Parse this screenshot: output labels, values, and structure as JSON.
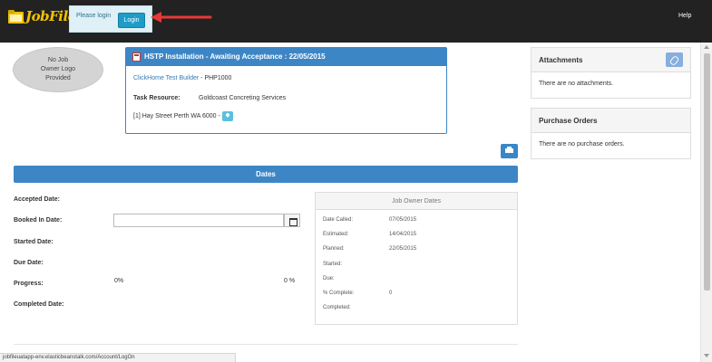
{
  "navbar": {
    "logo_text": "JobFile",
    "login_prompt": "Please login",
    "login_button": "Login",
    "help_link": "Help"
  },
  "owner_logo": {
    "line1": "No Job",
    "line2": "Owner Logo",
    "line3": "Provided"
  },
  "task": {
    "title": "HSTP Installation - Awaiting Acceptance : 22/05/2015",
    "builder_link": "ClickHome Test Builder",
    "builder_suffix": " - PHP1000",
    "resource_label": "Task Resource:",
    "resource_value": "Goldcoast Concreting Services",
    "address": "[1] Hay Street Perth WA 6000 -"
  },
  "dates": {
    "header": "Dates",
    "accepted_label": "Accepted Date:",
    "booked_label": "Booked In Date:",
    "booked_value": "",
    "started_label": "Started Date:",
    "due_label": "Due Date:",
    "progress_label": "Progress:",
    "progress_left": "0%",
    "progress_right": "0 %",
    "completed_label": "Completed Date:"
  },
  "owner_dates": {
    "header": "Job Owner Dates",
    "rows": [
      {
        "label": "Date Called:",
        "value": "07/05/2015"
      },
      {
        "label": "Estimated:",
        "value": "14/04/2015"
      },
      {
        "label": "Planned:",
        "value": "22/05/2015"
      },
      {
        "label": "Started:",
        "value": ""
      },
      {
        "label": "Due:",
        "value": ""
      },
      {
        "label": "% Complete:",
        "value": "0"
      },
      {
        "label": "Completed:",
        "value": ""
      }
    ]
  },
  "attachments": {
    "title": "Attachments",
    "empty_text": "There are no attachments."
  },
  "purchase_orders": {
    "title": "Purchase Orders",
    "empty_text": "There are no purchase orders."
  },
  "status_bar": {
    "url": "jobfileuatapp-env.elasticbeanstalk.com/Account/LogOn"
  },
  "colors": {
    "navbar": "#222222",
    "primary": "#3d86c6",
    "login_button": "#1e9cc8",
    "annotation_arrow": "#e53935"
  },
  "icons": {
    "logo": "folder-logo-icon",
    "task_header": "document-icon",
    "map": "map-marker-icon",
    "print": "print-icon",
    "calendar": "calendar-icon",
    "attach": "paperclip-icon"
  }
}
